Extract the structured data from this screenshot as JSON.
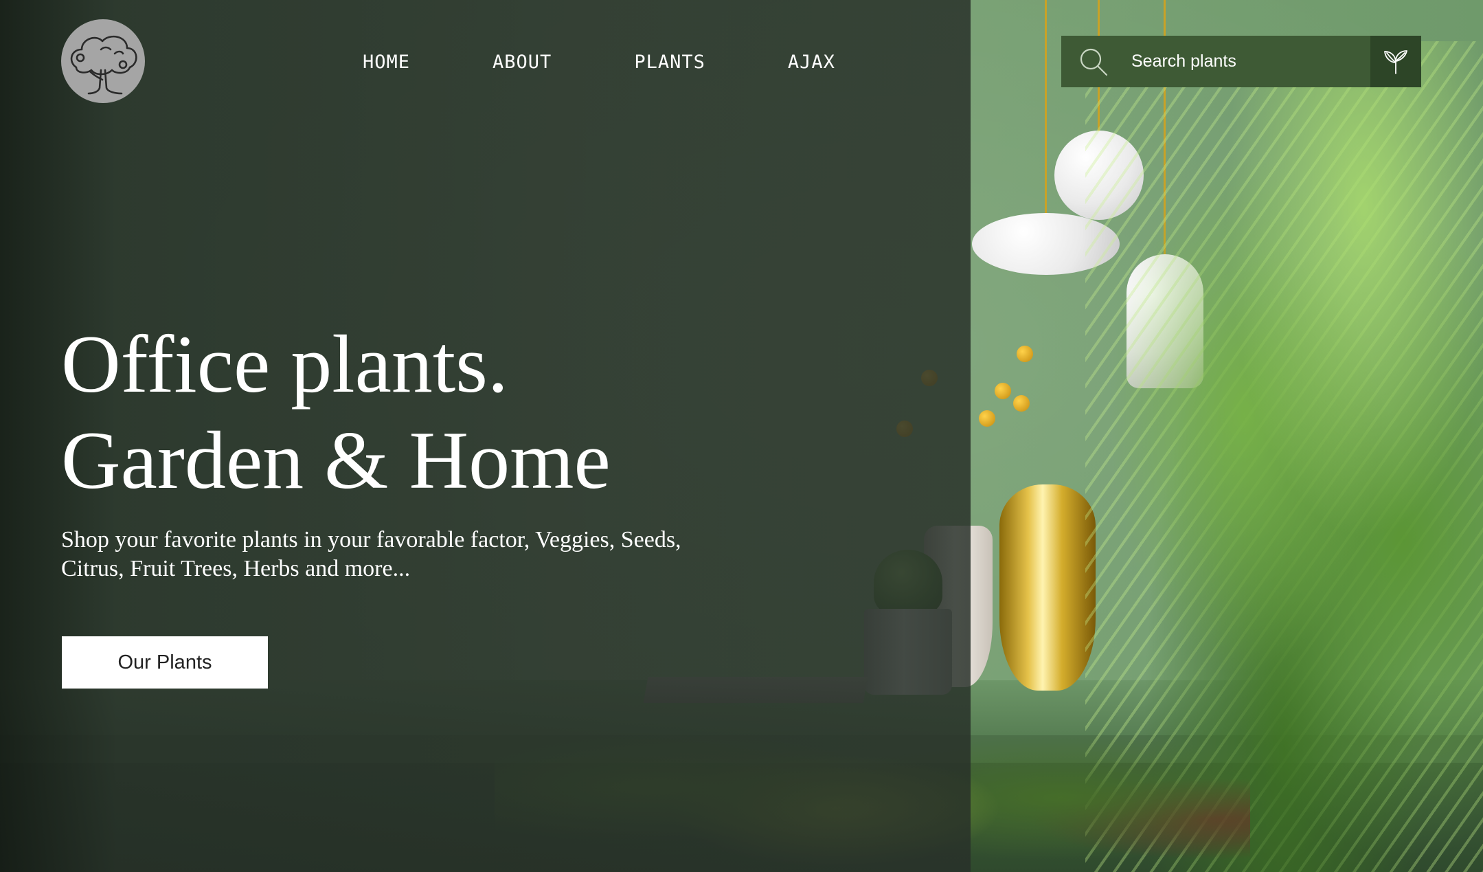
{
  "brand": {
    "logo_icon": "tree-logo-icon"
  },
  "nav": {
    "items": [
      {
        "label": "HOME"
      },
      {
        "label": "ABOUT"
      },
      {
        "label": "PLANTS"
      },
      {
        "label": "AJAX"
      }
    ]
  },
  "search": {
    "placeholder": "Search plants",
    "icon": "search-icon",
    "button_icon": "sprout-icon"
  },
  "hero": {
    "title_line1": "Office plants.",
    "title_line2": "Garden & Home",
    "subtitle_line1": "Shop your favorite plants in your favorable factor, Veggies, Seeds,",
    "subtitle_line2": "Citrus, Fruit Trees, Herbs and more...",
    "cta_label": "Our Plants"
  },
  "colors": {
    "overlay": "#2b352d",
    "search_bg": "#3e5a35",
    "search_button_bg": "#2d4527",
    "text": "#ffffff",
    "cta_bg": "#ffffff"
  }
}
